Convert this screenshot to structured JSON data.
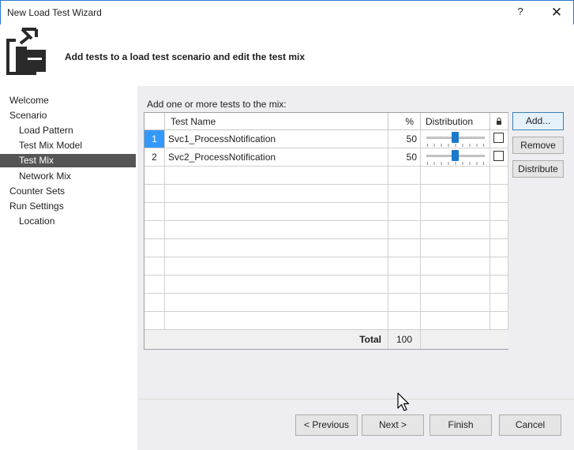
{
  "window": {
    "title": "New Load Test Wizard",
    "help_glyph": "?",
    "close_glyph": "✕"
  },
  "header": {
    "heading": "Add tests to a load test scenario and edit the test mix"
  },
  "nav": {
    "items": [
      {
        "label": "Welcome"
      },
      {
        "label": "Scenario"
      },
      {
        "label": "Load Pattern"
      },
      {
        "label": "Test Mix Model"
      },
      {
        "label": "Test Mix"
      },
      {
        "label": "Network Mix"
      },
      {
        "label": "Counter Sets"
      },
      {
        "label": "Run Settings"
      },
      {
        "label": "Location"
      }
    ],
    "selected": "Test Mix"
  },
  "main": {
    "instruction": "Add one or more tests to the mix:",
    "columns": {
      "name": "Test Name",
      "pct": "%",
      "dist": "Distribution"
    },
    "rows": [
      {
        "num": "1",
        "name": "Svc1_ProcessNotification",
        "pct": "50",
        "slider_fraction": 0.5,
        "locked": false
      },
      {
        "num": "2",
        "name": "Svc2_ProcessNotification",
        "pct": "50",
        "slider_fraction": 0.5,
        "locked": false
      }
    ],
    "total_label": "Total",
    "total_value": "100"
  },
  "side_buttons": {
    "add": "Add...",
    "remove": "Remove",
    "distribute": "Distribute"
  },
  "footer": {
    "previous": "< Previous",
    "next": "Next >",
    "finish": "Finish",
    "cancel": "Cancel"
  },
  "colors": {
    "accent": "#1979ca",
    "selection": "#555555",
    "panel": "#eeeef2",
    "row_selected": "#3399ff"
  }
}
